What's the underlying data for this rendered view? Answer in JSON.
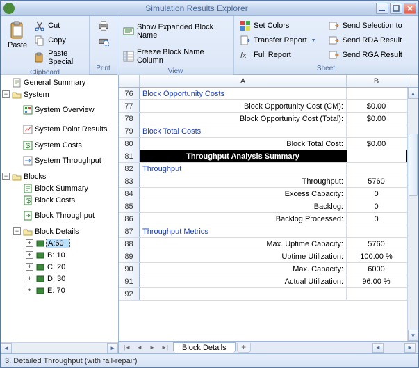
{
  "window": {
    "title": "Simulation Results Explorer"
  },
  "ribbon": {
    "clipboard": {
      "label": "Clipboard",
      "paste": "Paste",
      "cut": "Cut",
      "copy": "Copy",
      "paste_special": "Paste Special"
    },
    "print": {
      "label": "Print"
    },
    "view": {
      "label": "View",
      "show_expanded": "Show Expanded Block Name",
      "freeze": "Freeze Block Name Column"
    },
    "sheet": {
      "label": "Sheet",
      "set_colors": "Set Colors",
      "transfer_report": "Transfer Report",
      "full_report": "Full Report",
      "send_selection": "Send Selection to",
      "send_rda": "Send RDA Result",
      "send_rga": "Send RGA Result"
    }
  },
  "tree": {
    "general_summary": "General Summary",
    "system": "System",
    "system_overview": "System Overview",
    "system_point_results": "System Point Results",
    "system_costs": "System Costs",
    "system_throughput": "System Throughput",
    "blocks": "Blocks",
    "block_summary": "Block Summary",
    "block_costs": "Block Costs",
    "block_throughput": "Block Throughput",
    "block_details": "Block Details",
    "a60": "A:60",
    "b10": "B: 10",
    "c20": "C: 20",
    "d30": "D: 30",
    "e70": "E: 70"
  },
  "sheet": {
    "columns": {
      "a": "A",
      "b": "B"
    },
    "rows": [
      {
        "n": 76,
        "type": "section",
        "a": "Block Opportunity Costs",
        "b": ""
      },
      {
        "n": 77,
        "type": "data",
        "a": "Block Opportunity Cost (CM):",
        "b": "$0.00"
      },
      {
        "n": 78,
        "type": "data",
        "a": "Block Opportunity Cost (Total):",
        "b": "$0.00"
      },
      {
        "n": 79,
        "type": "section",
        "a": "Block Total Costs",
        "b": ""
      },
      {
        "n": 80,
        "type": "data",
        "a": "Block Total Cost:",
        "b": "$0.00"
      },
      {
        "n": 81,
        "type": "summary",
        "a": "Throughput Analysis Summary",
        "b": ""
      },
      {
        "n": 82,
        "type": "section",
        "a": "Throughput",
        "b": ""
      },
      {
        "n": 83,
        "type": "data",
        "a": "Throughput:",
        "b": "5760"
      },
      {
        "n": 84,
        "type": "data",
        "a": "Excess Capacity:",
        "b": "0"
      },
      {
        "n": 85,
        "type": "data",
        "a": "Backlog:",
        "b": "0"
      },
      {
        "n": 86,
        "type": "data",
        "a": "Backlog Processed:",
        "b": "0"
      },
      {
        "n": 87,
        "type": "section",
        "a": "Throughput Metrics",
        "b": ""
      },
      {
        "n": 88,
        "type": "data",
        "a": "Max. Uptime Capacity:",
        "b": "5760"
      },
      {
        "n": 89,
        "type": "data",
        "a": "Uptime Utilization:",
        "b": "100.00 %"
      },
      {
        "n": 90,
        "type": "data",
        "a": "Max. Capacity:",
        "b": "6000"
      },
      {
        "n": 91,
        "type": "data",
        "a": "Actual Utilization:",
        "b": "96.00 %"
      },
      {
        "n": 92,
        "type": "blank",
        "a": "",
        "b": ""
      }
    ],
    "tab": "Block Details"
  },
  "status": {
    "text": "3. Detailed Throughput (with fail-repair)"
  },
  "chart_data": {
    "type": "table",
    "title": "Throughput Analysis Summary",
    "sections": [
      {
        "name": "Block Opportunity Costs",
        "rows": [
          {
            "label": "Block Opportunity Cost (CM)",
            "value": 0.0,
            "unit": "$"
          },
          {
            "label": "Block Opportunity Cost (Total)",
            "value": 0.0,
            "unit": "$"
          }
        ]
      },
      {
        "name": "Block Total Costs",
        "rows": [
          {
            "label": "Block Total Cost",
            "value": 0.0,
            "unit": "$"
          }
        ]
      },
      {
        "name": "Throughput",
        "rows": [
          {
            "label": "Throughput",
            "value": 5760
          },
          {
            "label": "Excess Capacity",
            "value": 0
          },
          {
            "label": "Backlog",
            "value": 0
          },
          {
            "label": "Backlog Processed",
            "value": 0
          }
        ]
      },
      {
        "name": "Throughput Metrics",
        "rows": [
          {
            "label": "Max. Uptime Capacity",
            "value": 5760
          },
          {
            "label": "Uptime Utilization",
            "value": 100.0,
            "unit": "%"
          },
          {
            "label": "Max. Capacity",
            "value": 6000
          },
          {
            "label": "Actual Utilization",
            "value": 96.0,
            "unit": "%"
          }
        ]
      }
    ]
  }
}
